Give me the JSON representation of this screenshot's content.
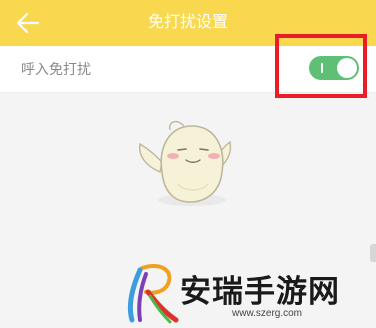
{
  "header": {
    "title": "免打扰设置",
    "back_icon": "arrow-left-icon"
  },
  "settings": {
    "incoming_dnd": {
      "label": "呼入免打扰",
      "enabled": true
    }
  },
  "colors": {
    "header": "#f9d850",
    "toggle_on": "#5fbf74",
    "highlight": "#ea1d26"
  },
  "watermark": {
    "name": "安瑞手游网",
    "url": "www.szerg.com"
  }
}
